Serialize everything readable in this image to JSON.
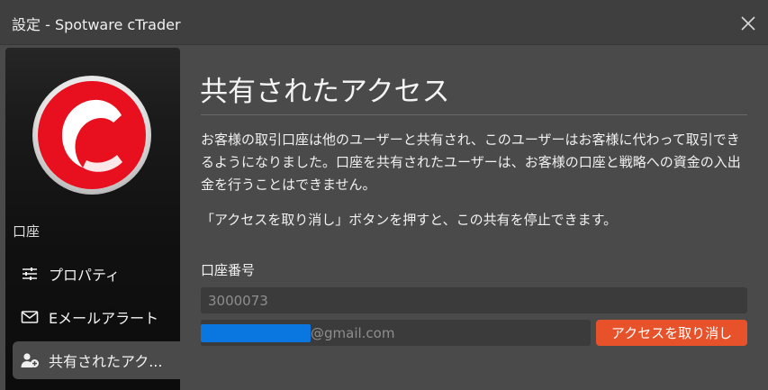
{
  "window": {
    "title": "設定 - Spotware cTrader"
  },
  "sidebar": {
    "logo": "ctrader-logo",
    "section_label": "口座",
    "items": [
      {
        "label": "プロパティ",
        "icon": "sliders-icon",
        "active": false
      },
      {
        "label": "Eメールアラート",
        "icon": "envelope-icon",
        "active": false
      },
      {
        "label": "共有されたアク...",
        "icon": "add-user-icon",
        "active": true
      }
    ]
  },
  "main": {
    "title": "共有されたアクセス",
    "paragraphs": [
      "お客様の取引口座は他のユーザーと共有され、このユーザーはお客様に代わって取引できるようになりました。口座を共有されたユーザーは、お客様の口座と戦略への資金の入出金を行うことはできません。",
      "「アクセスを取り消し」ボタンを押すと、この共有を停止できます。"
    ],
    "account_label": "口座番号",
    "account_number": "3000073",
    "shared_email_suffix": "@gmail.com",
    "revoke_button": "アクセスを取り消し"
  },
  "colors": {
    "accent": "#e8522a",
    "redaction": "#0a77e0",
    "logo_red": "#e8101e"
  }
}
